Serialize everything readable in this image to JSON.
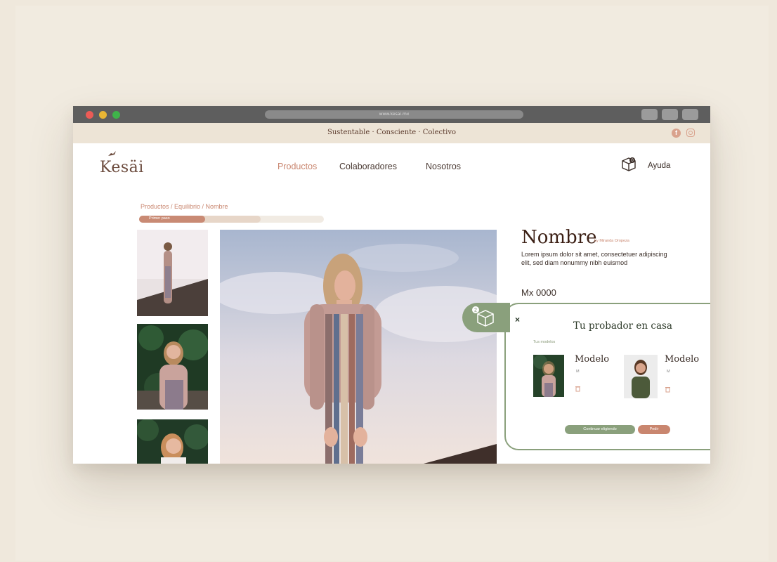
{
  "browser": {
    "url": "www.kesai.mx"
  },
  "top_strip": {
    "tagline": "Sustentable · Consciente · Colectivo",
    "social": [
      "facebook-icon",
      "instagram-icon"
    ]
  },
  "header": {
    "logo": "Kesäi",
    "nav": {
      "productos": "Productos",
      "colaboradores": "Colaboradores",
      "nosotros": "Nosotros"
    },
    "cart_count": "0",
    "help": "Ayuda"
  },
  "breadcrumb": "Productos / Equilibrio / Nombre",
  "progress": {
    "label": "Primer paso",
    "fraction": 0.36
  },
  "product": {
    "name": "Nombre",
    "by": "by Miranda Oropeza",
    "description": "Lorem ipsum dolor sit amet, consectetuer adipiscing elit, sed diam nonummy nibh euismod",
    "price": "Mx 0000"
  },
  "try_panel": {
    "badge_count": "2",
    "close": "×",
    "title": "Tu probador en casa",
    "subtitle": "Tus modelos",
    "models": [
      {
        "name": "Modelo",
        "size": "M"
      },
      {
        "name": "Modelo",
        "size": "M"
      }
    ],
    "buttons": {
      "continue": "Continuar eligiendo",
      "order": "Pedir"
    }
  },
  "colors": {
    "accent": "#c9866f",
    "green": "#8aa07c",
    "brown": "#3b1f14",
    "background": "#efe8dc"
  }
}
